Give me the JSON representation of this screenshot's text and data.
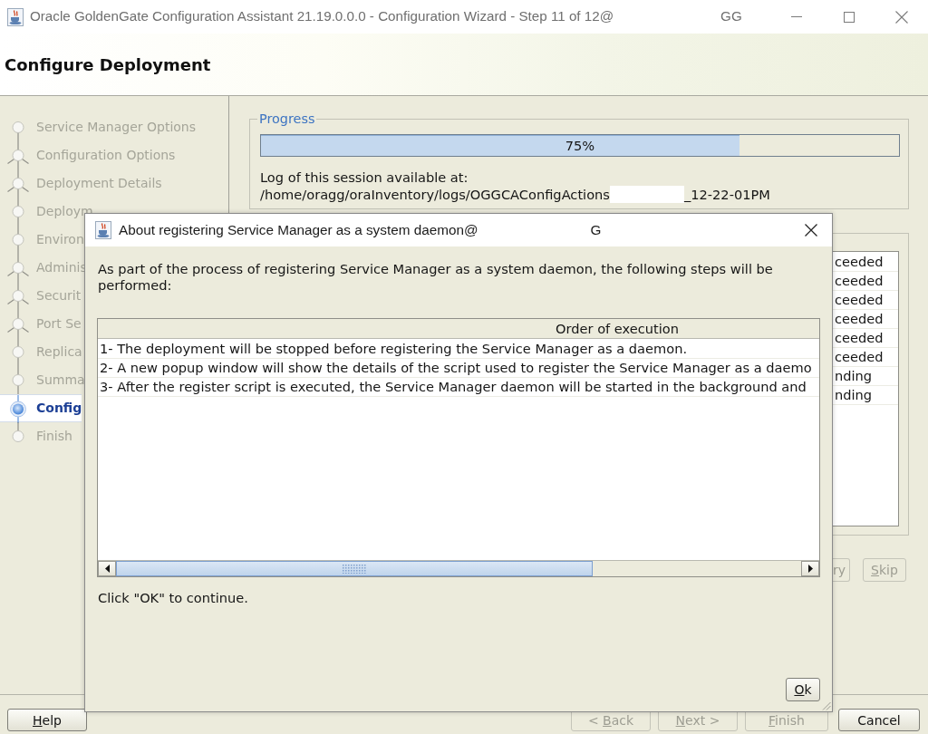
{
  "window": {
    "title": "Oracle GoldenGate Configuration Assistant 21.19.0.0.0 - Configuration Wizard - Step 11 of 12@",
    "title_tail": "GG"
  },
  "header": {
    "title": "Configure Deployment"
  },
  "steps": [
    {
      "label": "Service Manager Options",
      "kind": "plain",
      "selected": false
    },
    {
      "label": "Configuration Options",
      "kind": "branch",
      "selected": false
    },
    {
      "label": "Deployment Details",
      "kind": "branch",
      "selected": false
    },
    {
      "label": "Deploym",
      "kind": "plain",
      "selected": false
    },
    {
      "label": "Environ",
      "kind": "plain",
      "selected": false
    },
    {
      "label": "Adminis",
      "kind": "branch",
      "selected": false
    },
    {
      "label": "Securit",
      "kind": "branch",
      "selected": false
    },
    {
      "label": "Port Se",
      "kind": "branch",
      "selected": false
    },
    {
      "label": "Replica",
      "kind": "plain",
      "selected": false
    },
    {
      "label": "Summa",
      "kind": "plain",
      "selected": false
    },
    {
      "label": "Config",
      "kind": "plain",
      "selected": true
    },
    {
      "label": "Finish",
      "kind": "plain",
      "selected": false
    }
  ],
  "progress": {
    "title": "Progress",
    "level": 0.75,
    "reading": "75%",
    "log_label": "Log of this session available at:",
    "log_path": "/home/oragg/oraInventory/logs/OGGCAConfigActions",
    "log_path_tail": "_12-22-01PM"
  },
  "status_rows": [
    "ceeded",
    "ceeded",
    "ceeded",
    "ceeded",
    "ceeded",
    "ceeded",
    "nding",
    "nding"
  ],
  "step_buttons": [
    {
      "label": "ry",
      "mnemonic": false,
      "disabled": true
    },
    {
      "label": "Skip",
      "mnemonic": true,
      "disabled": true
    }
  ],
  "footer": {
    "left": [
      {
        "label": "Help",
        "mnemonic": true,
        "disabled": false
      }
    ],
    "right": [
      {
        "label": "< Back",
        "mnemonic": true,
        "disabled": true
      },
      {
        "label": "Next >",
        "mnemonic": true,
        "disabled": true
      },
      {
        "label": "Finish",
        "mnemonic": true,
        "disabled": true
      },
      {
        "label": "Cancel",
        "mnemonic": false,
        "disabled": false
      }
    ]
  },
  "dialog": {
    "title": "About registering Service Manager as a system daemon@",
    "title_tail": "G",
    "message": "As part of the process of registering Service Manager as a system daemon, the following steps will be performed:",
    "table": {
      "columns": [
        "Order of execution"
      ],
      "rows": [
        "1- The deployment will be stopped before registering the Service Manager as a daemon.",
        "2- A new popup window will show the details of the script used to register the Service Manager as a daemo",
        "3- After the register script is executed, the Service Manager daemon will be started in the background and"
      ]
    },
    "note": "Click \"OK\" to continue.",
    "buttons": [
      {
        "label": "Ok",
        "mnemonic": true,
        "disabled": false
      }
    ]
  }
}
